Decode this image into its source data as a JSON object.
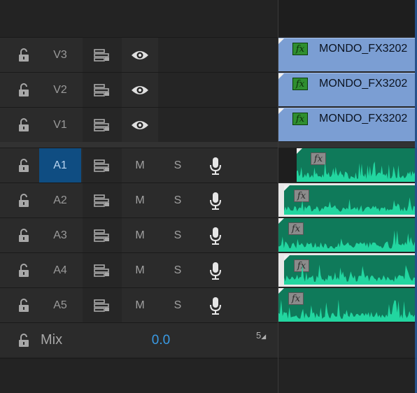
{
  "colors": {
    "video_clip": "#7b9ed3",
    "audio_clip": "#0f7a5a",
    "waveform": "#22d6a0",
    "active_track": "#0f4d82",
    "mix_value": "#3a9be5"
  },
  "video_tracks": [
    {
      "name": "V3",
      "clip_label": "MONDO_FX3202"
    },
    {
      "name": "V2",
      "clip_label": "MONDO_FX3202"
    },
    {
      "name": "V1",
      "clip_label": "MONDO_FX3202"
    }
  ],
  "audio_tracks": [
    {
      "name": "A1",
      "mute": "M",
      "solo": "S",
      "active": true
    },
    {
      "name": "A2",
      "mute": "M",
      "solo": "S",
      "active": false
    },
    {
      "name": "A3",
      "mute": "M",
      "solo": "S",
      "active": false
    },
    {
      "name": "A4",
      "mute": "M",
      "solo": "S",
      "active": false
    },
    {
      "name": "A5",
      "mute": "M",
      "solo": "S",
      "active": false
    }
  ],
  "fx_badge": "fx",
  "mix": {
    "label": "Mix",
    "value": "0.0",
    "channel_icon": "5"
  },
  "icons": {
    "lock": "lock-open-icon",
    "sync": "sync-lock-icon",
    "eye": "eye-icon",
    "mic": "microphone-icon"
  }
}
